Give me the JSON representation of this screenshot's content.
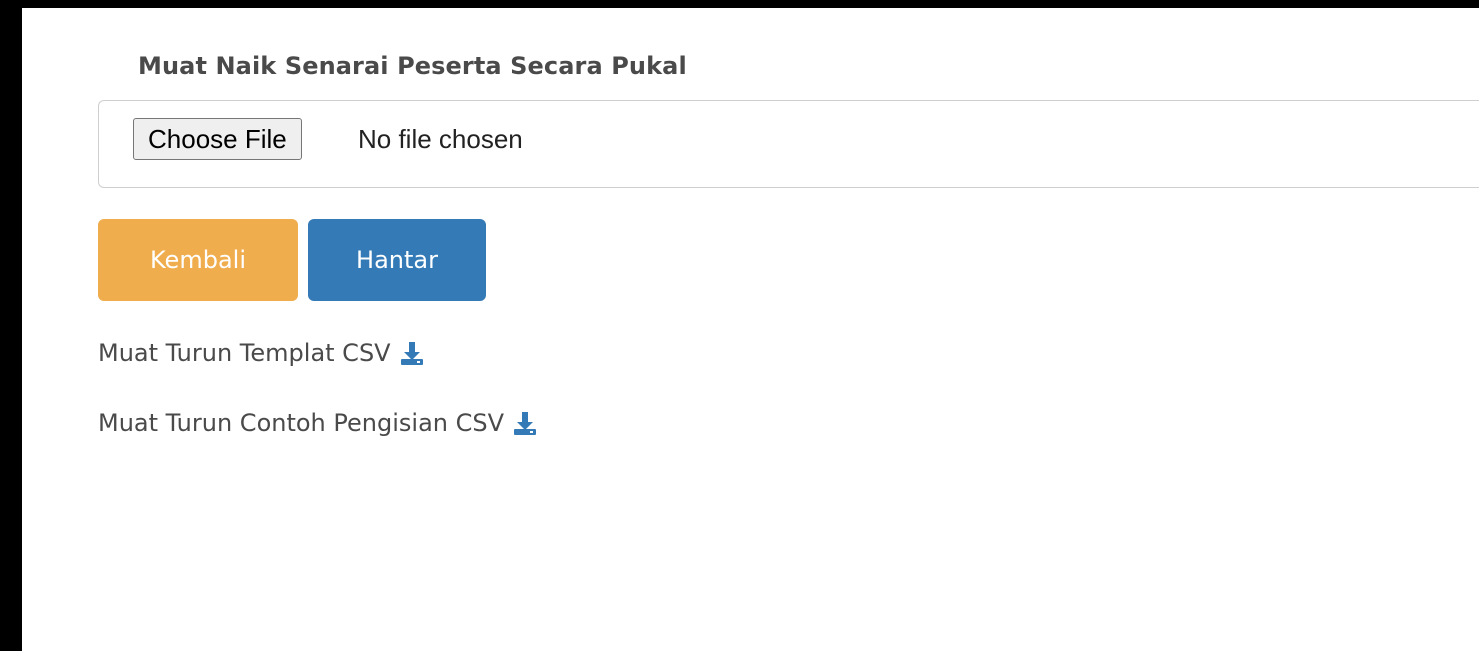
{
  "form": {
    "title": "Muat Naik Senarai Peserta Secara Pukal",
    "file_input": {
      "button_label": "Choose File",
      "status": "No file chosen"
    }
  },
  "actions": {
    "back_label": "Kembali",
    "submit_label": "Hantar",
    "back_color": "#f0ad4e",
    "submit_color": "#337ab7"
  },
  "downloads": {
    "template_label": "Muat Turun Templat CSV",
    "example_label": "Muat Turun Contoh Pengisian CSV",
    "icon": "download-icon",
    "icon_color": "#337ab7"
  }
}
